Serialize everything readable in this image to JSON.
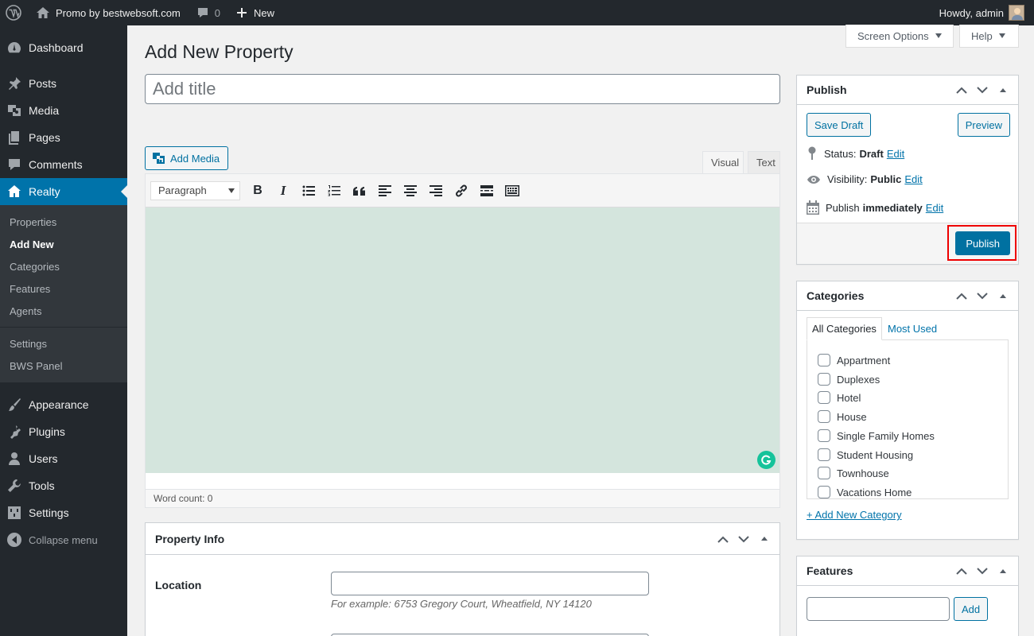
{
  "admin_bar": {
    "site_name": "Promo by bestwebsoft.com",
    "comments_count": "0",
    "new_label": "New",
    "howdy": "Howdy, admin"
  },
  "sidebar": {
    "dashboard": "Dashboard",
    "posts": "Posts",
    "media": "Media",
    "pages": "Pages",
    "comments": "Comments",
    "realty": "Realty",
    "submenu": [
      "Properties",
      "Add New",
      "Categories",
      "Features",
      "Agents",
      "Settings",
      "BWS Panel"
    ],
    "appearance": "Appearance",
    "plugins": "Plugins",
    "users": "Users",
    "tools": "Tools",
    "settings": "Settings",
    "collapse": "Collapse menu"
  },
  "screen_options": "Screen Options",
  "help": "Help",
  "page_title": "Add New Property",
  "title_placeholder": "Add title",
  "editor": {
    "add_media": "Add Media",
    "tab_visual": "Visual",
    "tab_text": "Text",
    "format": "Paragraph",
    "word_count": "Word count: 0"
  },
  "publish": {
    "title": "Publish",
    "save_draft": "Save Draft",
    "preview": "Preview",
    "status_label": "Status:",
    "status_value": "Draft",
    "visibility_label": "Visibility:",
    "visibility_value": "Public",
    "publish_label": "Publish",
    "publish_value": "immediately",
    "edit": "Edit",
    "publish_button": "Publish"
  },
  "categories": {
    "title": "Categories",
    "tab_all": "All Categories",
    "tab_most_used": "Most Used",
    "items": [
      "Appartment",
      "Duplexes",
      "Hotel",
      "House",
      "Single Family Homes",
      "Student Housing",
      "Townhouse",
      "Vacations Home"
    ],
    "add_new": "+ Add New Category"
  },
  "features": {
    "title": "Features",
    "add_button": "Add"
  },
  "property_info": {
    "title": "Property Info",
    "location_label": "Location",
    "location_hint": "For example: 6753 Gregory Court, Wheatfield, NY 14120"
  },
  "colors": {
    "admin_bar": "#23282d",
    "accent": "#0073aa",
    "editor_bg": "#d4e5dd",
    "highlight": "#ee0000"
  }
}
